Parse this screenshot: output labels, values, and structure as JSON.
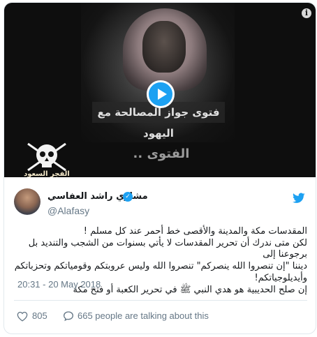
{
  "media": {
    "banner_text": "فتوى جواز المصالحة مع اليهود",
    "overlay_label": "الفتوى ..",
    "logo_text": "الفجر السعود",
    "info_label": "i"
  },
  "author": {
    "display_name": "مشاري راشد العفاسي",
    "handle": "@Alafasy",
    "verified": true
  },
  "tweet": {
    "lines": [
      "المقدسات مكة والمدينة والأقصى خط أحمر عند كل مسلم !",
      "لكن متى ندرك أن تحرير المقدسات لا يأتي بسنوات من الشجب والتنديد بل برجوعنا إلى",
      "ديننا \"إن تنصروا الله ينصركم\" تنصروا الله وليس عروبتكم وقومياتكم وتحزباتكم",
      "وأيديلوجياتكم!",
      "إن صلح الحديبية هو هدي النبي ﷺ في تحرير الكعبة أو فتح مكة"
    ],
    "timestamp": "20:31 - 20 May 2018"
  },
  "actions": {
    "like_count": "805",
    "talk_text": "665 people are talking about this"
  },
  "colors": {
    "accent": "#1da1f2",
    "muted": "#657786",
    "like": "#e0245e"
  }
}
